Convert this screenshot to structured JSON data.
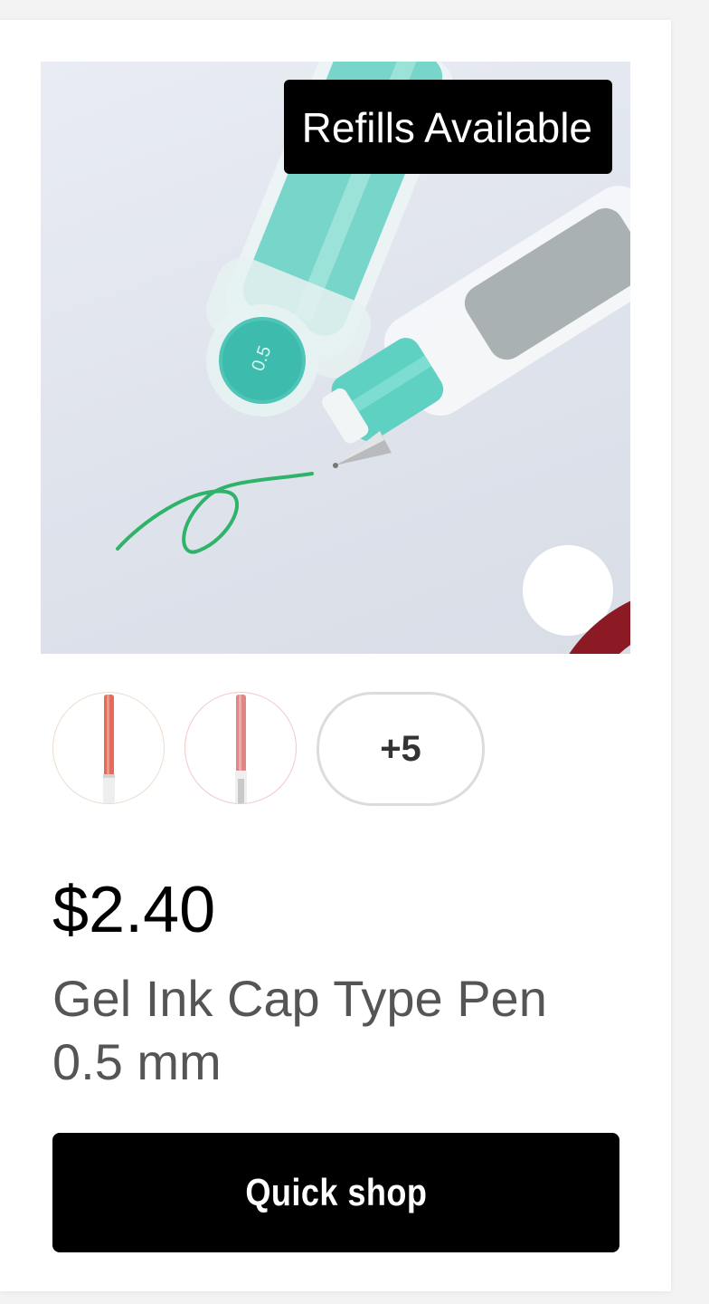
{
  "product": {
    "badge": "Refills Available",
    "favorite_icon": "heart-outline-icon",
    "image_text": "0.5",
    "swatches": [
      {
        "name": "red-pen"
      },
      {
        "name": "pink-pen"
      }
    ],
    "more_swatches_label": "+5",
    "price": "$2.40",
    "name": "Gel Ink Cap Type Pen 0.5 mm",
    "quick_shop_label": "Quick shop"
  },
  "colors": {
    "badge_bg": "#000000",
    "heart": "#8b1a24",
    "button_bg": "#000000",
    "pen_teal": "#4fc9b9",
    "ink_green": "#2fb36b"
  }
}
